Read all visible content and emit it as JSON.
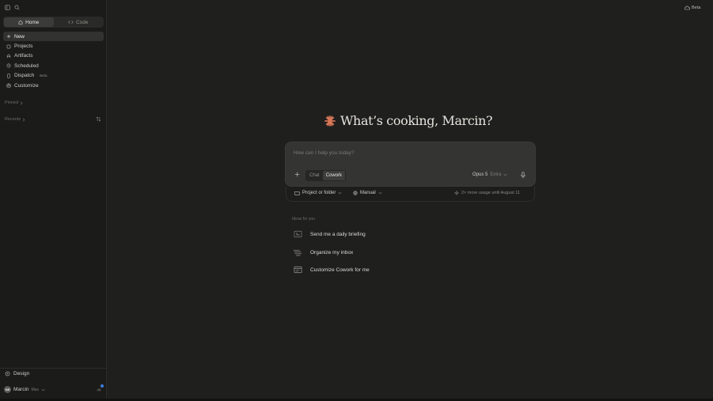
{
  "sidebar": {
    "segments": [
      {
        "label": "Home",
        "icon": "home-icon",
        "active": true
      },
      {
        "label": "Code",
        "icon": "code-icon",
        "active": false
      }
    ],
    "nav": [
      {
        "label": "New",
        "icon": "plus-icon",
        "active": true
      },
      {
        "label": "Projects",
        "icon": "folder-icon"
      },
      {
        "label": "Artifacts",
        "icon": "artifacts-icon"
      },
      {
        "label": "Scheduled",
        "icon": "clock-icon"
      },
      {
        "label": "Dispatch",
        "icon": "phone-icon",
        "badge": "Beta"
      },
      {
        "label": "Customize",
        "icon": "briefcase-icon"
      }
    ],
    "pinned_label": "Pinned",
    "recents_label": "Recents",
    "design_label": "Design",
    "user": {
      "initials": "MR",
      "name": "Marcin",
      "plan": "Max"
    }
  },
  "header": {
    "beta_label": "Beta"
  },
  "greeting": {
    "text": "What’s cooking, Marcin?",
    "accent_color": "#d97757"
  },
  "composer": {
    "placeholder": "How can I help you today?",
    "modes": [
      {
        "label": "Chat",
        "active": false
      },
      {
        "label": "Cowork",
        "active": true
      }
    ],
    "model": "Opus 5",
    "model_variant": "Extra"
  },
  "composer_bar": {
    "project_label": "Project or folder",
    "manual_label": "Manual",
    "usage_text": "2× more usage until August 11"
  },
  "ideas": {
    "label": "Ideas for you",
    "items": [
      {
        "label": "Send me a daily briefing",
        "icon": "calendar-icon"
      },
      {
        "label": "Organize my inbox",
        "icon": "lines-icon"
      },
      {
        "label": "Customize Cowork for me",
        "icon": "window-icon"
      }
    ]
  }
}
